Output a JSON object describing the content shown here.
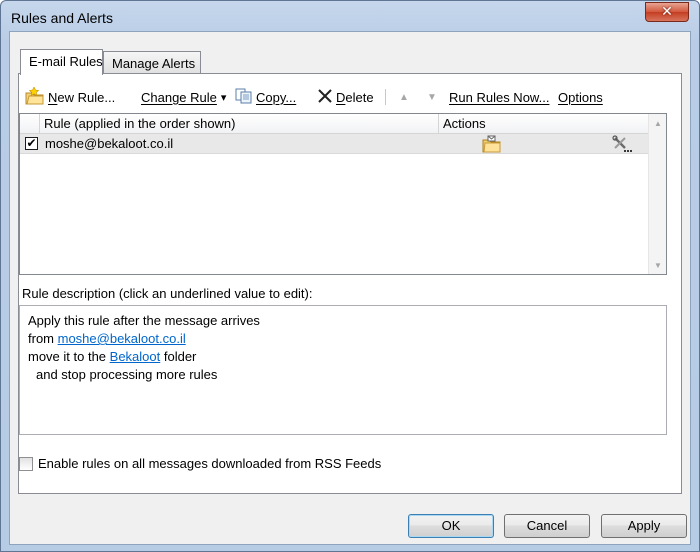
{
  "window": {
    "title": "Rules and Alerts",
    "close_glyph": "✕"
  },
  "tabs": [
    {
      "label": "E-mail Rules",
      "active": true
    },
    {
      "label": "Manage Alerts",
      "active": false
    }
  ],
  "toolbar": {
    "new_rule": {
      "mnemonic": "N",
      "rest": "ew Rule..."
    },
    "change_rule": {
      "mnemonic": "Change Rule",
      "dropdown": "▾"
    },
    "copy": {
      "mnemonic": "Copy...",
      "rest": ""
    },
    "delete": {
      "mnemonic": "D",
      "rest": "elete"
    },
    "move_up_glyph": "▲",
    "move_down_glyph": "▼",
    "run_rules_now": {
      "mnemonic": "Run Rules Now...",
      "rest": ""
    },
    "options": {
      "mnemonic": "Options",
      "rest": ""
    }
  },
  "rules_list": {
    "columns": [
      "Rule (applied in the order shown)",
      "Actions"
    ],
    "rows": [
      {
        "checked": true,
        "check_glyph": "✔",
        "name": "moshe@bekaloot.co.il",
        "action_icon": "move-to-folder-icon"
      }
    ]
  },
  "description": {
    "label": "Rule description (click an underlined value to edit):",
    "lines": {
      "l1": "Apply this rule after the message arrives",
      "l2_prefix": "from ",
      "l2_link": "moshe@bekaloot.co.il",
      "l3_prefix": "move it to the ",
      "l3_link": "Bekaloot",
      "l3_suffix": " folder",
      "l4": "and stop processing more rules"
    }
  },
  "rss": {
    "label": "Enable rules on all messages downloaded from RSS Feeds",
    "checked": false
  },
  "buttons": {
    "ok": "OK",
    "cancel": "Cancel",
    "apply": "Apply"
  },
  "colors": {
    "link": "#0066cc",
    "close_button": "#c43d21",
    "title_bar": "#b9cde6"
  }
}
